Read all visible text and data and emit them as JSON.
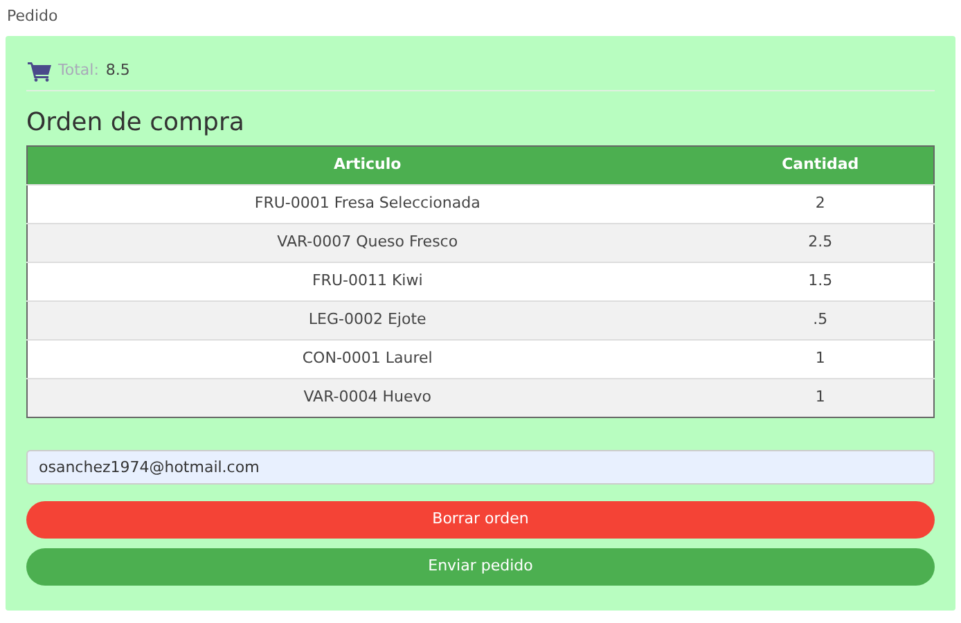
{
  "header": {
    "title": "Pedido"
  },
  "total": {
    "label": "Total:",
    "value": "8.5"
  },
  "order": {
    "title": "Orden de compra",
    "columns": [
      "Articulo",
      "Cantidad"
    ],
    "rows": [
      [
        "FRU-0001 Fresa Seleccionada",
        "2"
      ],
      [
        "VAR-0007 Queso Fresco",
        "2.5"
      ],
      [
        "FRU-0011 Kiwi",
        "1.5"
      ],
      [
        "LEG-0002 Ejote",
        ".5"
      ],
      [
        "CON-0001 Laurel",
        "1"
      ],
      [
        "VAR-0004 Huevo",
        "1"
      ]
    ]
  },
  "email": {
    "value": "osanchez1974@hotmail.com"
  },
  "buttons": [
    {
      "kind": "danger",
      "label": "Borrar orden"
    },
    {
      "kind": "success",
      "label": "Enviar pedido"
    }
  ]
}
